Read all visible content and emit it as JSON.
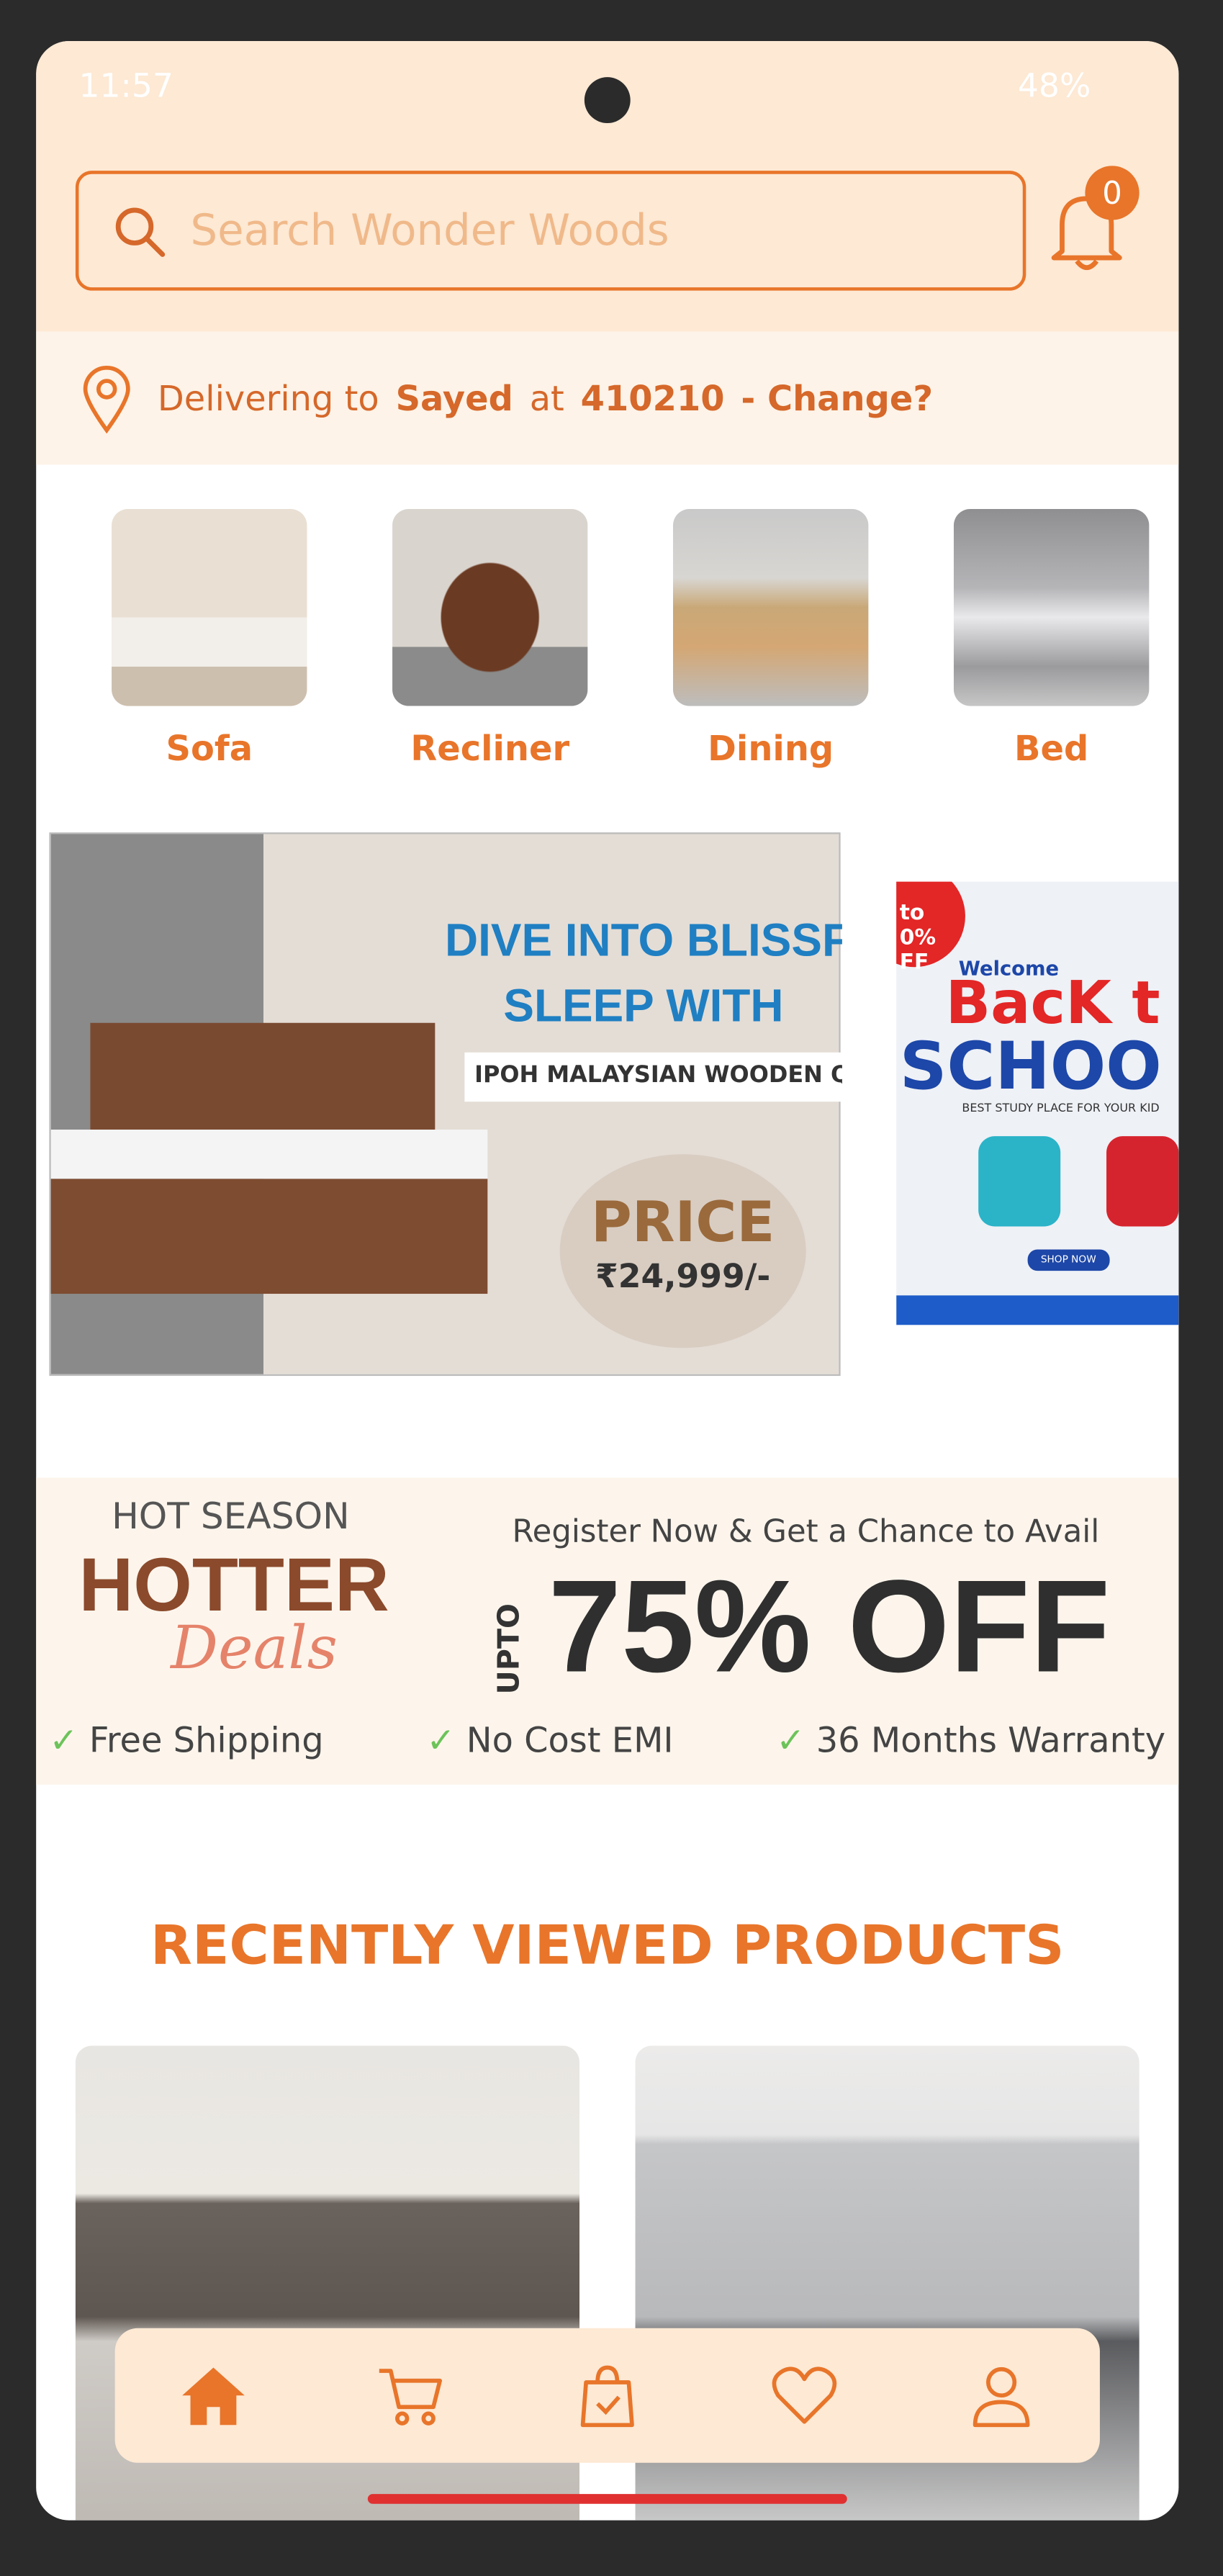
{
  "status_bar": {
    "time": "11:57",
    "battery": "48%"
  },
  "search": {
    "placeholder": "Search Wonder Woods",
    "icon": "search-icon"
  },
  "notifications": {
    "count": "0",
    "icon": "bell-icon"
  },
  "delivery": {
    "prefix": "Delivering to",
    "name": "Sayed",
    "at": "at",
    "pincode": "410210",
    "change": "- Change?"
  },
  "categories": [
    {
      "label": "Sofa"
    },
    {
      "label": "Recliner"
    },
    {
      "label": "Dining"
    },
    {
      "label": "Bed"
    }
  ],
  "banners": [
    {
      "line1": "DIVE INTO BLISSFU",
      "line2": "SLEEP WITH",
      "line3": "IPOH MALAYSIAN WOODEN QUEEN B",
      "price_label": "PRICE",
      "price": "₹24,999/-"
    },
    {
      "corner": "to 0% FF",
      "welcome": "Welcome",
      "title1": "BacK t",
      "title2": "SCHOO",
      "tagline": "BEST STUDY PLACE FOR YOUR KID",
      "cta": "SHOP NOW"
    }
  ],
  "promo": {
    "kicker": "HOT SEASON",
    "title": "HOTTER",
    "script": "Deals",
    "register": "Register Now & Get a Chance to Avail",
    "upto": "UPTO",
    "offer": "75% OFF",
    "features": [
      "Free Shipping",
      "No Cost EMI",
      "36 Months Warranty"
    ]
  },
  "recent": {
    "heading": "RECENTLY VIEWED PRODUCTS"
  },
  "nav": [
    "home",
    "cart",
    "orders",
    "wishlist",
    "profile"
  ],
  "colors": {
    "accent": "#e8752a",
    "header_bg": "#fde9d4",
    "delivery_bg": "#fdf3e8"
  }
}
